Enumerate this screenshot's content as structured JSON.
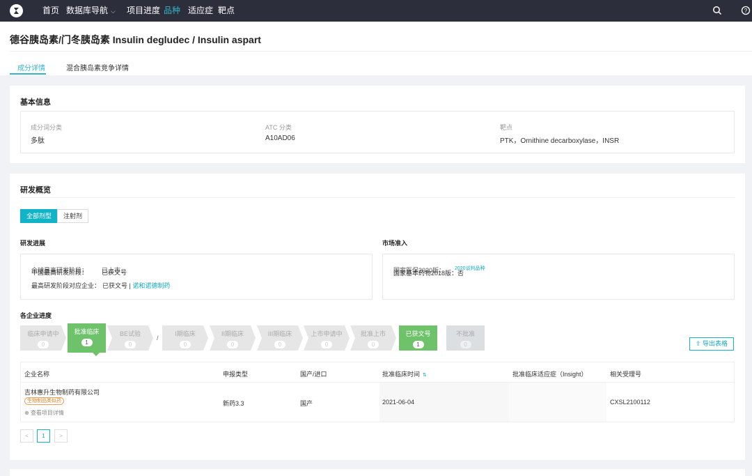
{
  "nav": {
    "items": [
      "首页",
      "数据库导航",
      "项目进度",
      "品种",
      "适应症",
      "靶点"
    ],
    "active_index": 3
  },
  "page": {
    "title": "德谷胰岛素/门冬胰岛素 Insulin degludec / Insulin aspart",
    "tabs": [
      "成分详情",
      "混合胰岛素竞争详情"
    ],
    "active_tab": 0
  },
  "basic_info": {
    "title": "基本信息",
    "fields": [
      {
        "label": "成分词分类",
        "value": "多肽"
      },
      {
        "label": "ATC 分类",
        "value": "A10AD06"
      },
      {
        "label": "靶点",
        "value": "PTK，Ornithine decarboxylase，INSR"
      }
    ]
  },
  "rd": {
    "title": "研发概览",
    "segments": [
      "全部剂型",
      "注射剂"
    ],
    "progress": {
      "title": "研发进展",
      "line1_label": "中国最高研发阶段：",
      "line1_value": "已获文号",
      "line1_ghost_label": "全球最高研发阶段：",
      "line1_ghost_value": "已上市",
      "line2_label": "最高研发阶段对应企业：",
      "line2_value": "已获文号 |",
      "line2_link": "诺和诺德制药"
    },
    "market": {
      "title": "市场准入",
      "line_label": "国家医保2020版：",
      "line_ghost": "国家基本药物2018版：否",
      "line_link": "2020谈判品种"
    },
    "stages_title": "各企业进度",
    "stages": [
      {
        "name": "临床申请中",
        "count": "0"
      },
      {
        "name": "批准临床",
        "count": "1"
      },
      {
        "name": "BE试验",
        "count": "0"
      },
      {
        "name": "I期临床",
        "count": "0"
      },
      {
        "name": "II期临床",
        "count": "0"
      },
      {
        "name": "III期临床",
        "count": "0"
      },
      {
        "name": "上市申请中",
        "count": "0"
      },
      {
        "name": "批准上市",
        "count": "0"
      },
      {
        "name": "已获文号",
        "count": "1"
      },
      {
        "name": "不批准",
        "count": "0"
      }
    ],
    "slash": "/",
    "export_label": "导出表格",
    "table": {
      "headers": [
        "企业名称",
        "申报类型",
        "国产/进口",
        "批准临床时间",
        "批准临床适应症（Insight）",
        "相关受理号"
      ],
      "row": {
        "company": "吉林惠升生物制药有限公司",
        "tag": "生物制品类似药",
        "detail_link": "查看项目详情",
        "type": "新药3.3",
        "origin": "国产",
        "date": "2021-06-04",
        "indication": "",
        "accept_no": "CXSL2100112"
      }
    },
    "pager": {
      "prev": "<",
      "current": "1",
      "next": ">"
    }
  },
  "colors": {
    "accent": "#11b3c7",
    "nav_bg": "#2c2f3b",
    "green": "#6ec26a"
  }
}
